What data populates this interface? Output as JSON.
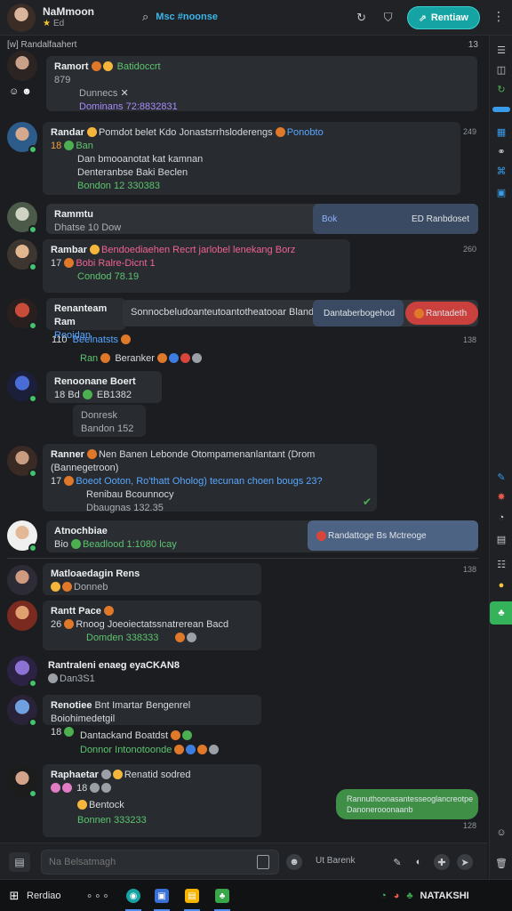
{
  "header": {
    "title": "NaMmoon",
    "subtitle": "Ed",
    "center_label": "Msc #noonse",
    "action_label": "Rentiaw",
    "accent": "#16a3a3",
    "icons": [
      "search-icon",
      "refresh-icon",
      "shield-icon",
      "link-icon",
      "menu-icon"
    ]
  },
  "section": {
    "title": "[w] Randalfaahert",
    "count": "13"
  },
  "messages": [
    {
      "name": "Ramort",
      "reactions": "Batidoccrt",
      "line1": "879",
      "line2": "Dunnecs",
      "line3": "Dominans 72:8832831",
      "time": ""
    },
    {
      "name": "Randar",
      "headline": "Pomdot belet Kdo Jonastsrrhsloderengs",
      "link": "Ponobto",
      "line1": "Ban",
      "line2": "Dan bmooanotat kat kamnan",
      "line3": "Denteranbse Baki Beclen",
      "meta": "Bondon 12 330383",
      "time": "249"
    },
    {
      "name": "Rammtu",
      "line1": "Dhatse 10 Dow",
      "chip_left": "Bok",
      "chip_right": "ED Ranbdoset",
      "time": ""
    },
    {
      "name": "Rambar",
      "headline": "Bendoediaehen Recrt jarlobel lenekang Borz",
      "line1": "17",
      "line2": "Bobi Ralre-Dicnt 1",
      "meta": "Condod 78.19",
      "time": "260"
    },
    {
      "name": "Renanteam Ram",
      "line1": "Sonnocbeludoanteutoantotheatooar Bland",
      "tag": "Reoidan",
      "chip_left": "Dantaberbogehod",
      "chip_right": "Rantadeth",
      "time": ""
    },
    {
      "name": "",
      "line1": "110",
      "line2": "Beelnatsts",
      "line3": "Ran",
      "line4": "Beranker",
      "time": "138"
    },
    {
      "name": "Renoonane Boert",
      "line1": "18 Bd",
      "line2": "EB1382",
      "line3": "Donresk",
      "meta": "Bandon 152",
      "time": ""
    },
    {
      "name": "Ranner",
      "headline": "Nen Banen Lebonde Otompamenanlantant (Drom (Bannegetroon)",
      "line1": "17",
      "line2": "Boeot Ooton, Ro'thatt Oholog) tecunan choen bougs 23?",
      "line3": "Renibau Bcounnocy",
      "meta": "Dbaugnas 132.35",
      "time": ""
    },
    {
      "name": "Atnochbiae",
      "line1": "Bio",
      "meta": "Beadlood 1:1080 lcay",
      "chip": "Randattoge Bs Mctreoge",
      "time": ""
    },
    {
      "name": "Matloaedagin Rens",
      "line1": "Donneb",
      "time": "138"
    },
    {
      "name": "Rantt Pace",
      "line1": "26",
      "line2": "Rnoog Joeoiectatssnatrerean Bacd",
      "meta": "Domden 338333",
      "time": ""
    },
    {
      "name": "Rantraleni enaeg eyaCKAN8",
      "line1": "Dan3S1",
      "time": ""
    },
    {
      "name": "Renotiee",
      "headline": "Bnt Imartar Bengenrel Boiohimedetgil",
      "line1": "18",
      "line2": "Dantackand Boatdst",
      "meta": "Donnor Intonotoonde",
      "time": ""
    },
    {
      "name": "Raphaetar",
      "headline": "Renatid sodred",
      "line1": "18",
      "line2": "Bentock",
      "meta": "Bonnen 333233",
      "chip": "Rannuthoonasantesseoglancreotpe Danonerooonaanb",
      "time": "128"
    }
  ],
  "composer": {
    "placeholder": "Na Belsatmagh",
    "label": "Ut Barenk"
  },
  "taskbar": {
    "start_label": "Rerdiao",
    "tray_label": "NATAKSHI"
  }
}
